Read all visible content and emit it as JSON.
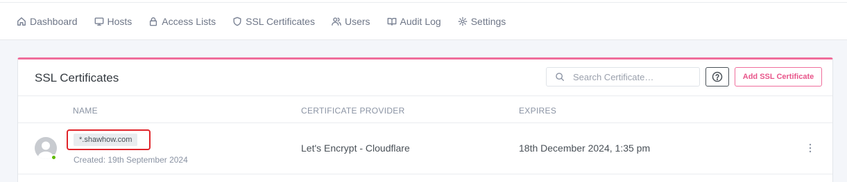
{
  "nav": {
    "items": [
      {
        "label": "Dashboard",
        "icon": "home-icon"
      },
      {
        "label": "Hosts",
        "icon": "monitor-icon"
      },
      {
        "label": "Access Lists",
        "icon": "lock-icon"
      },
      {
        "label": "SSL Certificates",
        "icon": "shield-icon"
      },
      {
        "label": "Users",
        "icon": "users-icon"
      },
      {
        "label": "Audit Log",
        "icon": "book-icon"
      },
      {
        "label": "Settings",
        "icon": "gear-icon"
      }
    ]
  },
  "card": {
    "title": "SSL Certificates",
    "search_placeholder": "Search Certificate…",
    "add_label": "Add SSL Certificate"
  },
  "table": {
    "columns": [
      "NAME",
      "CERTIFICATE PROVIDER",
      "EXPIRES"
    ],
    "rows": [
      {
        "domain": "*.shawhow.com",
        "created": "Created: 19th September 2024",
        "provider": "Let's Encrypt - Cloudflare",
        "expires": "18th December 2024, 1:35 pm",
        "status": "online"
      }
    ]
  },
  "colors": {
    "accent": "#ef6d9b",
    "status_online": "#5eba00",
    "highlight_box": "#e0242a"
  }
}
